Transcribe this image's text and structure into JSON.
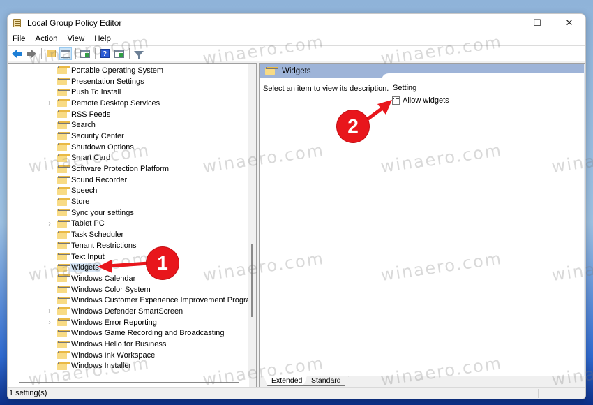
{
  "window": {
    "title": "Local Group Policy Editor",
    "controls": {
      "minimize": "—",
      "maximize": "☐",
      "close": "✕"
    }
  },
  "menu": [
    "File",
    "Action",
    "View",
    "Help"
  ],
  "toolbar": {
    "buttons": [
      {
        "name": "back",
        "icon": "back-arrow-icon"
      },
      {
        "name": "forward",
        "icon": "forward-arrow-icon"
      },
      {
        "name": "up-one-level",
        "icon": "folder-up-icon"
      },
      {
        "name": "show-hide-console-tree",
        "icon": "console-tree-icon",
        "active": true
      },
      {
        "name": "export-list",
        "icon": "export-list-icon"
      },
      {
        "name": "help",
        "icon": "help-icon"
      },
      {
        "name": "show-hide-action-pane",
        "icon": "action-pane-icon"
      },
      {
        "name": "filter",
        "icon": "filter-icon"
      }
    ]
  },
  "tree": {
    "items": [
      {
        "label": "Portable Operating System",
        "expandable": false
      },
      {
        "label": "Presentation Settings",
        "expandable": false
      },
      {
        "label": "Push To Install",
        "expandable": false
      },
      {
        "label": "Remote Desktop Services",
        "expandable": true
      },
      {
        "label": "RSS Feeds",
        "expandable": false
      },
      {
        "label": "Search",
        "expandable": false
      },
      {
        "label": "Security Center",
        "expandable": false
      },
      {
        "label": "Shutdown Options",
        "expandable": false
      },
      {
        "label": "Smart Card",
        "expandable": false
      },
      {
        "label": "Software Protection Platform",
        "expandable": false
      },
      {
        "label": "Sound Recorder",
        "expandable": false
      },
      {
        "label": "Speech",
        "expandable": false
      },
      {
        "label": "Store",
        "expandable": false
      },
      {
        "label": "Sync your settings",
        "expandable": false
      },
      {
        "label": "Tablet PC",
        "expandable": true
      },
      {
        "label": "Task Scheduler",
        "expandable": false
      },
      {
        "label": "Tenant Restrictions",
        "expandable": false
      },
      {
        "label": "Text Input",
        "expandable": false
      },
      {
        "label": "Widgets",
        "expandable": false,
        "selected": true
      },
      {
        "label": "Windows Calendar",
        "expandable": false
      },
      {
        "label": "Windows Color System",
        "expandable": false
      },
      {
        "label": "Windows Customer Experience Improvement Program",
        "expandable": false
      },
      {
        "label": "Windows Defender SmartScreen",
        "expandable": true
      },
      {
        "label": "Windows Error Reporting",
        "expandable": true
      },
      {
        "label": "Windows Game Recording and Broadcasting",
        "expandable": false
      },
      {
        "label": "Windows Hello for Business",
        "expandable": false
      },
      {
        "label": "Windows Ink Workspace",
        "expandable": false
      },
      {
        "label": "Windows Installer",
        "expandable": false
      }
    ],
    "expander_glyph": "›"
  },
  "details": {
    "header_title": "Widgets",
    "description": "Select an item to view its description.",
    "column_header": "Setting",
    "settings": [
      {
        "label": "Allow widgets"
      }
    ],
    "tabs": [
      {
        "label": "Extended",
        "active": true
      },
      {
        "label": "Standard",
        "active": false
      }
    ]
  },
  "statusbar": {
    "text": "1 setting(s)"
  },
  "annotations": [
    {
      "number": "1",
      "target": "Widgets"
    },
    {
      "number": "2",
      "target": "Allow widgets"
    }
  ],
  "watermark": "winaero.com",
  "colors": {
    "header_band": "#9eb4d8",
    "selection": "#d9e8f7",
    "callout": "#e8161c",
    "folder": "#f1c95c"
  }
}
